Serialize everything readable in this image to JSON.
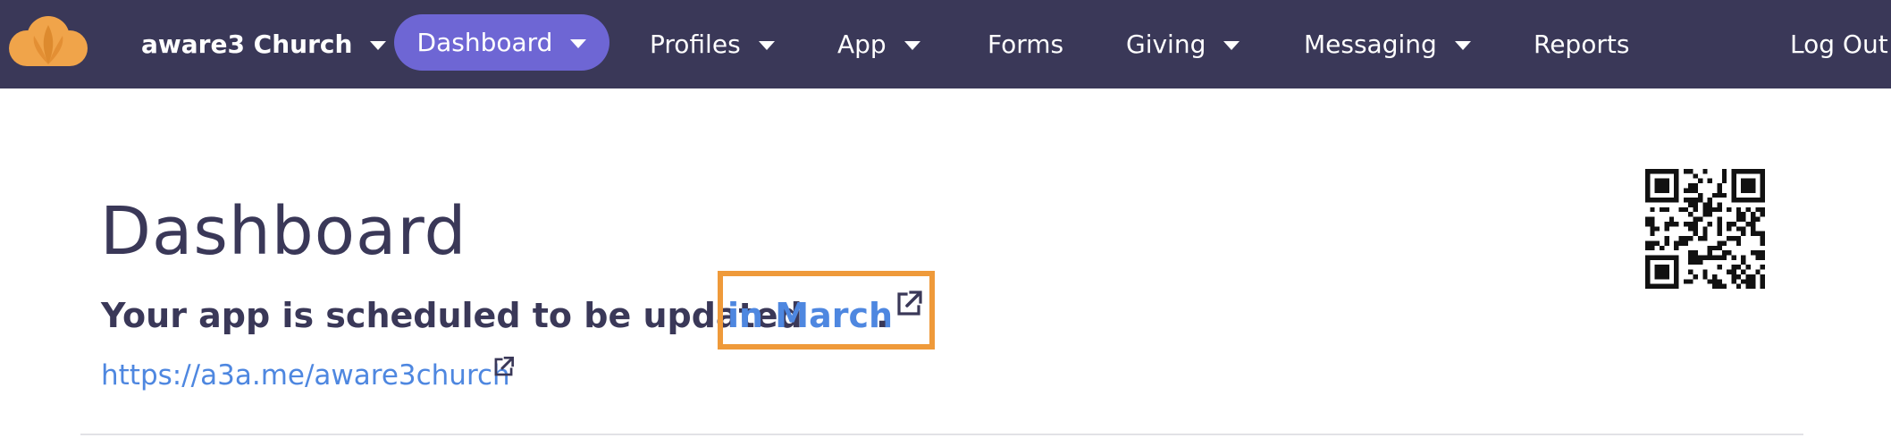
{
  "nav": {
    "org_name": "aware3 Church",
    "items": [
      {
        "label": "Dashboard",
        "active": true,
        "dropdown": true
      },
      {
        "label": "Profiles",
        "dropdown": true
      },
      {
        "label": "App",
        "dropdown": true
      },
      {
        "label": "Forms",
        "dropdown": false
      },
      {
        "label": "Giving",
        "dropdown": true
      },
      {
        "label": "Messaging",
        "dropdown": true
      },
      {
        "label": "Reports",
        "dropdown": false
      },
      {
        "label": "Log Out",
        "dropdown": false
      }
    ]
  },
  "main": {
    "title": "Dashboard",
    "update_prefix": "Your app is scheduled to be updated",
    "update_link": "in March",
    "update_suffix": ".",
    "app_url": "https://a3a.me/aware3church"
  },
  "icons": {
    "logo": "cloud-logo-icon",
    "dropdown": "caret-down-icon",
    "external": "external-link-icon",
    "qr": "qr-code-icon"
  },
  "colors": {
    "nav_bg": "#3a3858",
    "active_pill": "#6e66d4",
    "link": "#4e87e0",
    "highlight_border": "#ef9a3a",
    "logo": "#f0a44a",
    "heading_text": "#3a3858"
  }
}
